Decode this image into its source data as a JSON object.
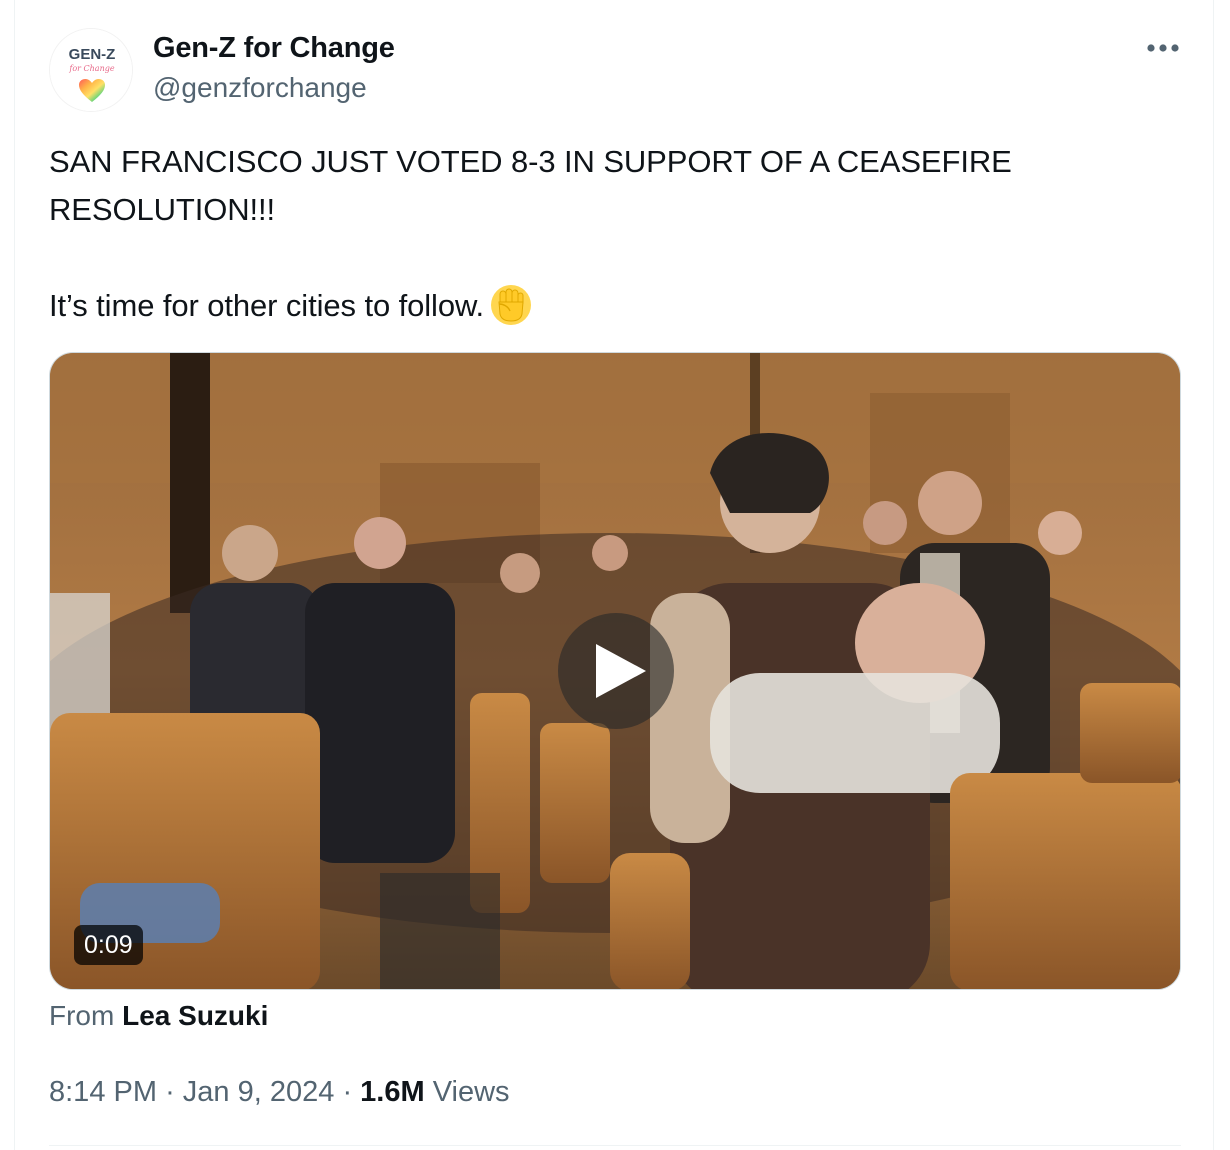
{
  "author": {
    "display_name": "Gen-Z for Change",
    "handle": "@genzforchange",
    "avatar_text_top": "GEN-Z",
    "avatar_text_script": "for Change",
    "avatar_icon": "rainbow-heart-icon"
  },
  "menu": {
    "icon": "more-horizontal-icon"
  },
  "tweet": {
    "line1": "SAN FRANCISCO JUST VOTED 8-3 IN SUPPORT OF A CEASEFIRE RESOLUTION!!!",
    "line2": "It’s time for other cities to follow.",
    "emoji": "raised-fist-icon"
  },
  "media": {
    "type": "video",
    "duration": "0:09",
    "play_icon": "play-icon",
    "from_label": "From",
    "from_author": "Lea Suzuki"
  },
  "meta": {
    "time": "8:14 PM",
    "separator": "·",
    "date": "Jan 9, 2024",
    "views_count": "1.6M",
    "views_label": "Views"
  },
  "colors": {
    "text": "#0f1419",
    "secondary": "#536471",
    "border": "#cfd9de",
    "divider": "#eff3f4"
  }
}
